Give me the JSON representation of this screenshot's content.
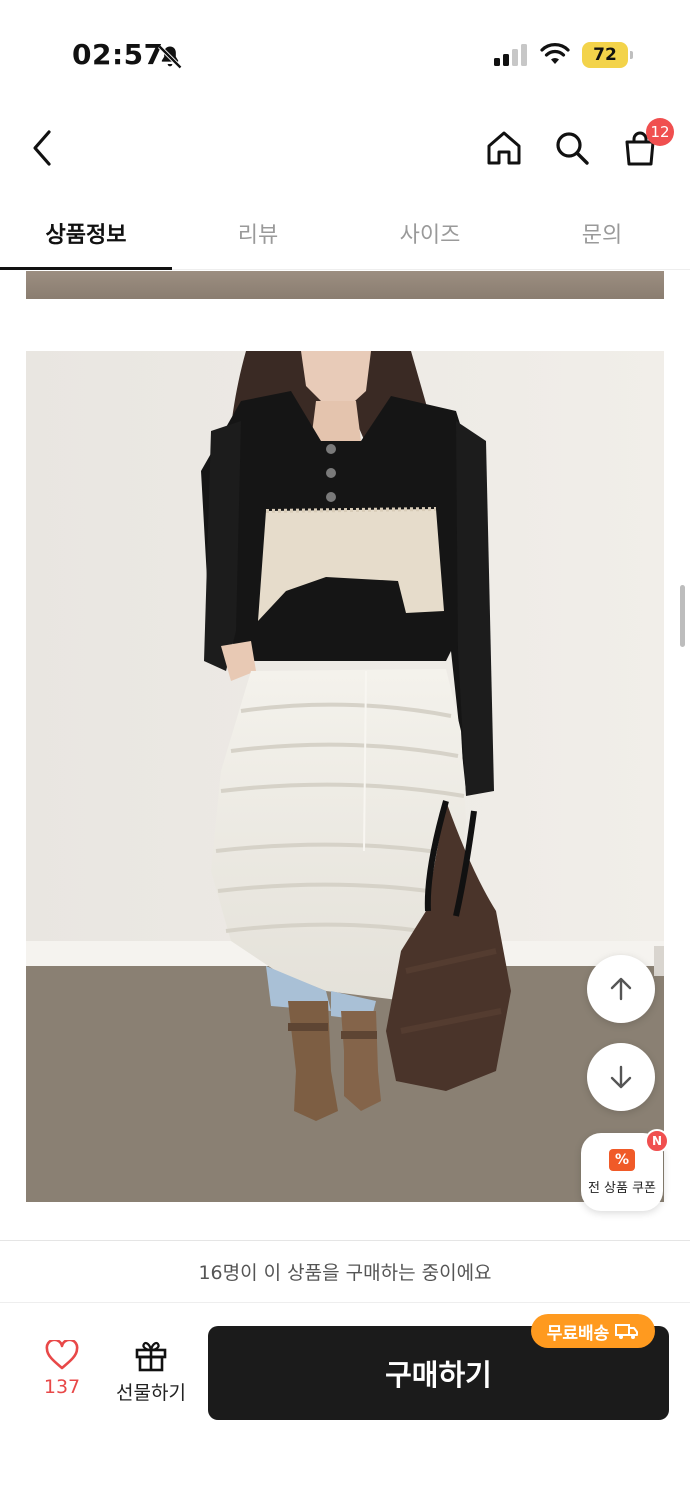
{
  "status_bar": {
    "time": "02:57",
    "battery_level": "72",
    "icons": [
      "bell-off-icon",
      "signal-icon",
      "wifi-icon",
      "battery-icon"
    ]
  },
  "header": {
    "icons": [
      "back-icon",
      "home-icon",
      "search-icon",
      "cart-icon"
    ],
    "cart_count": "12"
  },
  "tabs": [
    {
      "label": "상품정보",
      "active": true
    },
    {
      "label": "리뷰",
      "active": false
    },
    {
      "label": "사이즈",
      "active": false
    },
    {
      "label": "문의",
      "active": false
    }
  ],
  "floating": {
    "coupon_label": "전 상품 쿠폰",
    "coupon_badge": "N",
    "coupon_icon_glyph": "%",
    "icons": [
      "arrow-up-icon",
      "arrow-down-icon",
      "coupon-icon"
    ]
  },
  "bottom_bar": {
    "buying_notice": "16명이 이 상품을 구매하는 중이에요",
    "like_count": "137",
    "gift_label": "선물하기",
    "buy_label": "구매하기",
    "free_shipping_label": "무료배송",
    "icons": [
      "heart-icon",
      "gift-icon",
      "truck-icon"
    ]
  },
  "colors": {
    "accent_red": "#f04f4f",
    "free_shipping_orange": "#ff9a1f",
    "buy_button": "#1b1b1b",
    "battery_yellow": "#f3d34a"
  }
}
